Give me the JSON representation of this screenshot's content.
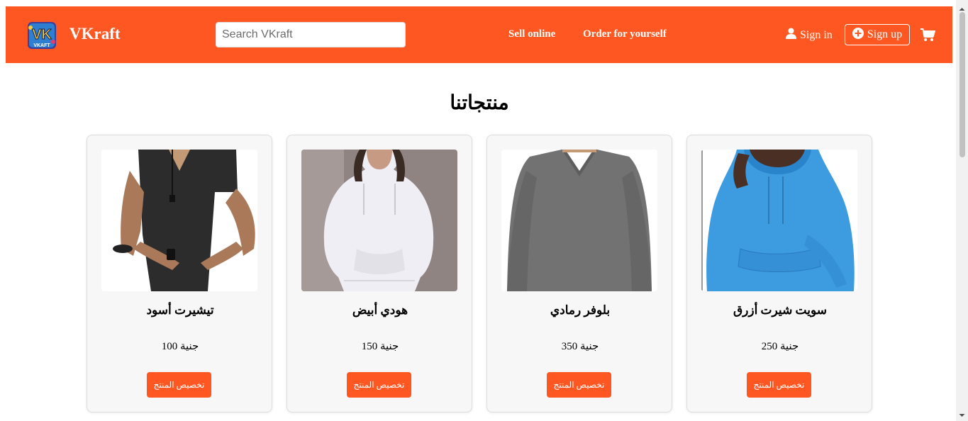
{
  "header": {
    "brand": "VKraft",
    "logo_text": "VK",
    "logo_subtext": "VKAFT",
    "search_placeholder": "Search VKraft",
    "nav_links": [
      "Sell online",
      "Order for yourself"
    ],
    "signin_label": "Sign in",
    "signup_label": "Sign up",
    "accent_color": "#ff5722",
    "icons": {
      "signin": "user-icon",
      "signup": "plus-circle-icon",
      "cart": "cart-icon"
    }
  },
  "main": {
    "title": "منتجاتنا",
    "products": [
      {
        "name": "تيشيرت أسود",
        "price": "جنية 100",
        "button": "تخصيص المنتج",
        "image": "black-tshirt"
      },
      {
        "name": "هودي أبيض",
        "price": "جنية 150",
        "button": "تخصيص المنتج",
        "image": "white-hoodie"
      },
      {
        "name": "بلوفر رمادي",
        "price": "جنية 350",
        "button": "تخصيص المنتج",
        "image": "gray-sweater"
      },
      {
        "name": "سويت شيرت أزرق",
        "price": "جنية 250",
        "button": "تخصيص المنتج",
        "image": "blue-hoodie"
      }
    ]
  }
}
